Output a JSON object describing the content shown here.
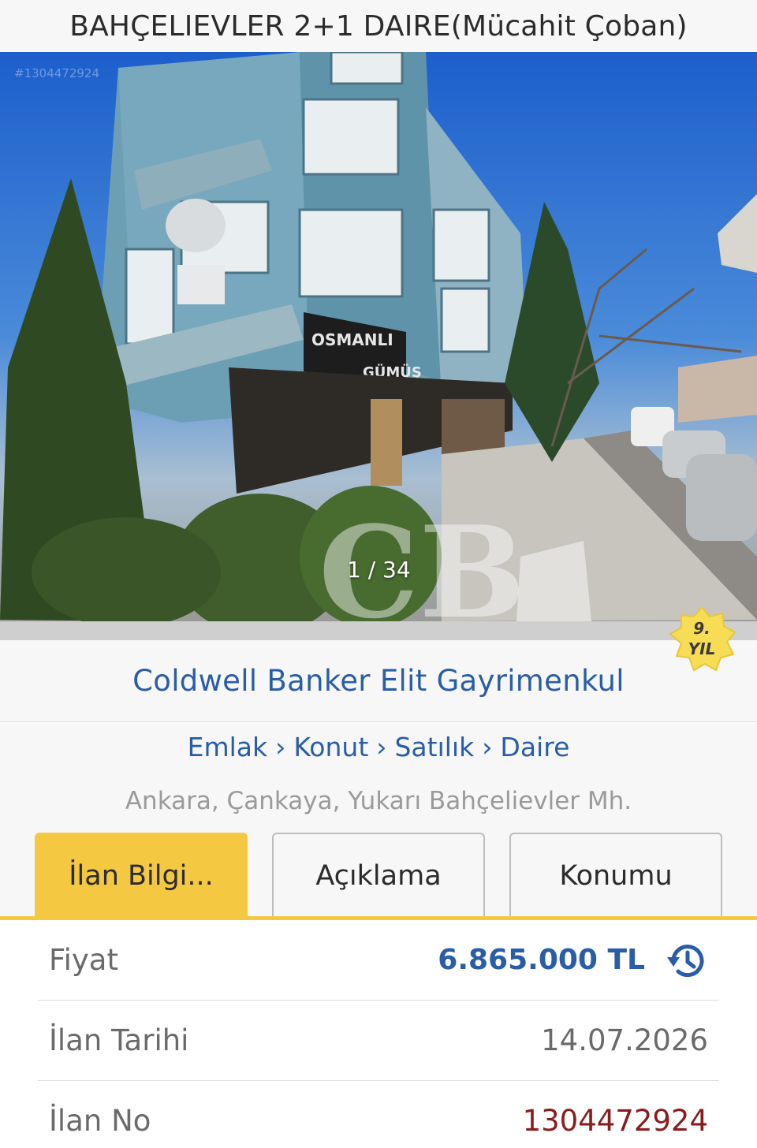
{
  "header": {
    "title": "BAHÇELIEVLER 2+1 DAIRE(Mücahit Çoban)"
  },
  "gallery": {
    "watermark_id": "#1304472924",
    "current": 1,
    "total": 34,
    "counter_text": "1 / 34",
    "shop_sign": "OSMANLI GÜMÜŞ"
  },
  "agency": {
    "name": "Coldwell Banker Elit Gayrimenkul",
    "badge_line1": "9.",
    "badge_line2": "YIL"
  },
  "breadcrumb": [
    "Emlak",
    "Konut",
    "Satılık",
    "Daire"
  ],
  "breadcrumb_separator": "›",
  "location": "Ankara, Çankaya, Yukarı Bahçelievler Mh.",
  "tabs": [
    {
      "label": "İlan Bilgi...",
      "active": true
    },
    {
      "label": "Açıklama",
      "active": false
    },
    {
      "label": "Konumu",
      "active": false
    }
  ],
  "details": [
    {
      "label": "Fiyat",
      "value": "6.865.000 TL"
    },
    {
      "label": "İlan Tarihi",
      "value": "14.07.2026"
    },
    {
      "label": "İlan No",
      "value": "1304472924"
    }
  ],
  "icons": {
    "price_history": "history-icon"
  },
  "colors": {
    "accent_yellow": "#f5c842",
    "link_blue": "#2a5da8",
    "ad_no_red": "#8a1c1c"
  }
}
